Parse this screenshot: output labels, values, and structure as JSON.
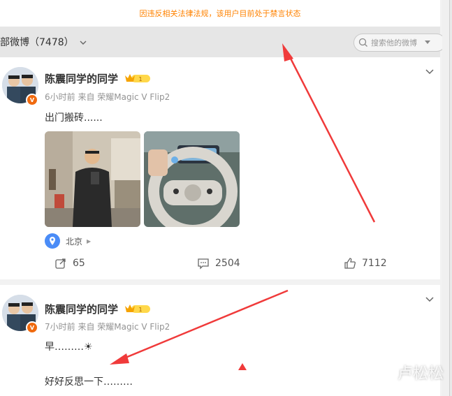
{
  "notice": "因违反相关法律法规，该用户目前处于禁言状态",
  "filter": {
    "label": "部微博（7478）"
  },
  "search": {
    "placeholder": "搜索他的微博"
  },
  "posts": [
    {
      "username": "陈震同学的同学",
      "level": "1",
      "time": "6小时前",
      "source": "来自 荣耀Magic V Flip2",
      "text": "出门搬砖......",
      "location": "北京",
      "reposts": "65",
      "comments": "2504",
      "likes": "7112"
    },
    {
      "username": "陈震同学的同学",
      "level": "1",
      "time": "7小时前",
      "source": "来自 荣耀Magic V Flip2",
      "text1": "早………☀",
      "text2": "好好反思一下………"
    }
  ],
  "watermark": "卢松松",
  "colors": {
    "notice": "#ff8200",
    "verified": "#f06a0f",
    "arrow": "#f03a3a",
    "location": "#4a8cf7"
  },
  "icons": [
    "chevron-down-icon",
    "search-icon",
    "crown-icon",
    "location-pin-icon",
    "repost-icon",
    "comment-icon",
    "like-icon"
  ]
}
